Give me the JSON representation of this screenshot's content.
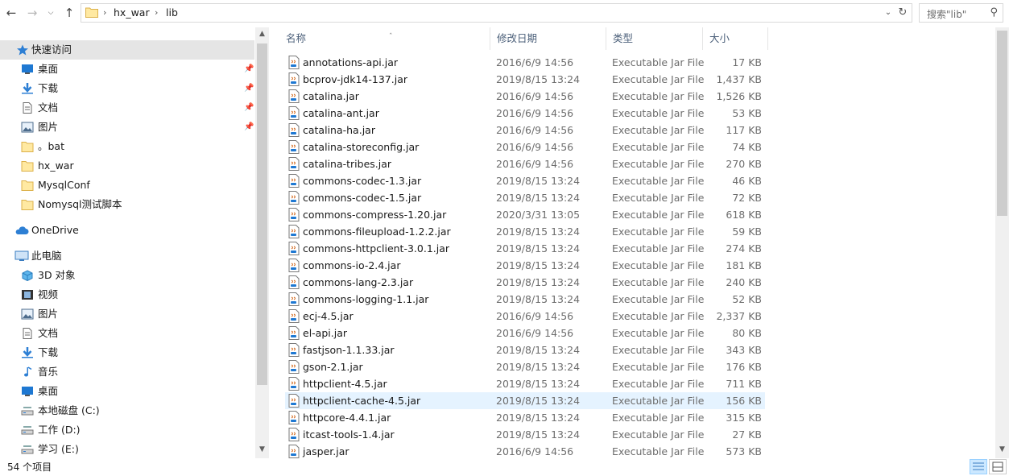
{
  "breadcrumb": [
    "hx_war",
    "lib"
  ],
  "search_placeholder": "搜索\"lib\"",
  "nav": {
    "quick_access": "快速访问",
    "quick_items": [
      {
        "label": "桌面",
        "icon": "desktop-icon",
        "pinned": true
      },
      {
        "label": "下载",
        "icon": "download-icon",
        "pinned": true
      },
      {
        "label": "文档",
        "icon": "document-icon",
        "pinned": true
      },
      {
        "label": "图片",
        "icon": "picture-icon",
        "pinned": true
      },
      {
        "label": "。bat",
        "icon": "folder-icon",
        "pinned": false
      },
      {
        "label": "hx_war",
        "icon": "folder-icon",
        "pinned": false
      },
      {
        "label": "MysqlConf",
        "icon": "folder-icon",
        "pinned": false
      },
      {
        "label": "Nomysql测试脚本",
        "icon": "folder-icon",
        "pinned": false
      }
    ],
    "onedrive": "OneDrive",
    "this_pc": "此电脑",
    "pc_items": [
      {
        "label": "3D 对象",
        "icon": "3d-objects-icon"
      },
      {
        "label": "视频",
        "icon": "video-icon"
      },
      {
        "label": "图片",
        "icon": "picture-icon"
      },
      {
        "label": "文档",
        "icon": "document-icon"
      },
      {
        "label": "下载",
        "icon": "download-icon"
      },
      {
        "label": "音乐",
        "icon": "music-icon"
      },
      {
        "label": "桌面",
        "icon": "desktop-icon"
      },
      {
        "label": "本地磁盘 (C:)",
        "icon": "drive-icon"
      },
      {
        "label": "工作 (D:)",
        "icon": "drive-icon"
      },
      {
        "label": "学习 (E:)",
        "icon": "drive-icon"
      }
    ]
  },
  "columns": {
    "name": "名称",
    "date": "修改日期",
    "type": "类型",
    "size": "大小"
  },
  "files": [
    {
      "name": "annotations-api.jar",
      "date": "2016/6/9 14:56",
      "type": "Executable Jar File",
      "size": "17 KB"
    },
    {
      "name": "bcprov-jdk14-137.jar",
      "date": "2019/8/15 13:24",
      "type": "Executable Jar File",
      "size": "1,437 KB"
    },
    {
      "name": "catalina.jar",
      "date": "2016/6/9 14:56",
      "type": "Executable Jar File",
      "size": "1,526 KB"
    },
    {
      "name": "catalina-ant.jar",
      "date": "2016/6/9 14:56",
      "type": "Executable Jar File",
      "size": "53 KB"
    },
    {
      "name": "catalina-ha.jar",
      "date": "2016/6/9 14:56",
      "type": "Executable Jar File",
      "size": "117 KB"
    },
    {
      "name": "catalina-storeconfig.jar",
      "date": "2016/6/9 14:56",
      "type": "Executable Jar File",
      "size": "74 KB"
    },
    {
      "name": "catalina-tribes.jar",
      "date": "2016/6/9 14:56",
      "type": "Executable Jar File",
      "size": "270 KB"
    },
    {
      "name": "commons-codec-1.3.jar",
      "date": "2019/8/15 13:24",
      "type": "Executable Jar File",
      "size": "46 KB"
    },
    {
      "name": "commons-codec-1.5.jar",
      "date": "2019/8/15 13:24",
      "type": "Executable Jar File",
      "size": "72 KB"
    },
    {
      "name": "commons-compress-1.20.jar",
      "date": "2020/3/31 13:05",
      "type": "Executable Jar File",
      "size": "618 KB"
    },
    {
      "name": "commons-fileupload-1.2.2.jar",
      "date": "2019/8/15 13:24",
      "type": "Executable Jar File",
      "size": "59 KB"
    },
    {
      "name": "commons-httpclient-3.0.1.jar",
      "date": "2019/8/15 13:24",
      "type": "Executable Jar File",
      "size": "274 KB"
    },
    {
      "name": "commons-io-2.4.jar",
      "date": "2019/8/15 13:24",
      "type": "Executable Jar File",
      "size": "181 KB"
    },
    {
      "name": "commons-lang-2.3.jar",
      "date": "2019/8/15 13:24",
      "type": "Executable Jar File",
      "size": "240 KB"
    },
    {
      "name": "commons-logging-1.1.jar",
      "date": "2019/8/15 13:24",
      "type": "Executable Jar File",
      "size": "52 KB"
    },
    {
      "name": "ecj-4.5.jar",
      "date": "2016/6/9 14:56",
      "type": "Executable Jar File",
      "size": "2,337 KB"
    },
    {
      "name": "el-api.jar",
      "date": "2016/6/9 14:56",
      "type": "Executable Jar File",
      "size": "80 KB"
    },
    {
      "name": "fastjson-1.1.33.jar",
      "date": "2019/8/15 13:24",
      "type": "Executable Jar File",
      "size": "343 KB"
    },
    {
      "name": "gson-2.1.jar",
      "date": "2019/8/15 13:24",
      "type": "Executable Jar File",
      "size": "176 KB"
    },
    {
      "name": "httpclient-4.5.jar",
      "date": "2019/8/15 13:24",
      "type": "Executable Jar File",
      "size": "711 KB"
    },
    {
      "name": "httpclient-cache-4.5.jar",
      "date": "2019/8/15 13:24",
      "type": "Executable Jar File",
      "size": "156 KB",
      "highlighted": true
    },
    {
      "name": "httpcore-4.4.1.jar",
      "date": "2019/8/15 13:24",
      "type": "Executable Jar File",
      "size": "315 KB"
    },
    {
      "name": "itcast-tools-1.4.jar",
      "date": "2019/8/15 13:24",
      "type": "Executable Jar File",
      "size": "27 KB"
    },
    {
      "name": "jasper.jar",
      "date": "2016/6/9 14:56",
      "type": "Executable Jar File",
      "size": "573 KB"
    }
  ],
  "status": "54 个项目",
  "colors": {
    "accent": "#0078d7",
    "hover": "#e5f3ff",
    "selected": "#e5e5e5",
    "header_text": "#4c607a"
  }
}
